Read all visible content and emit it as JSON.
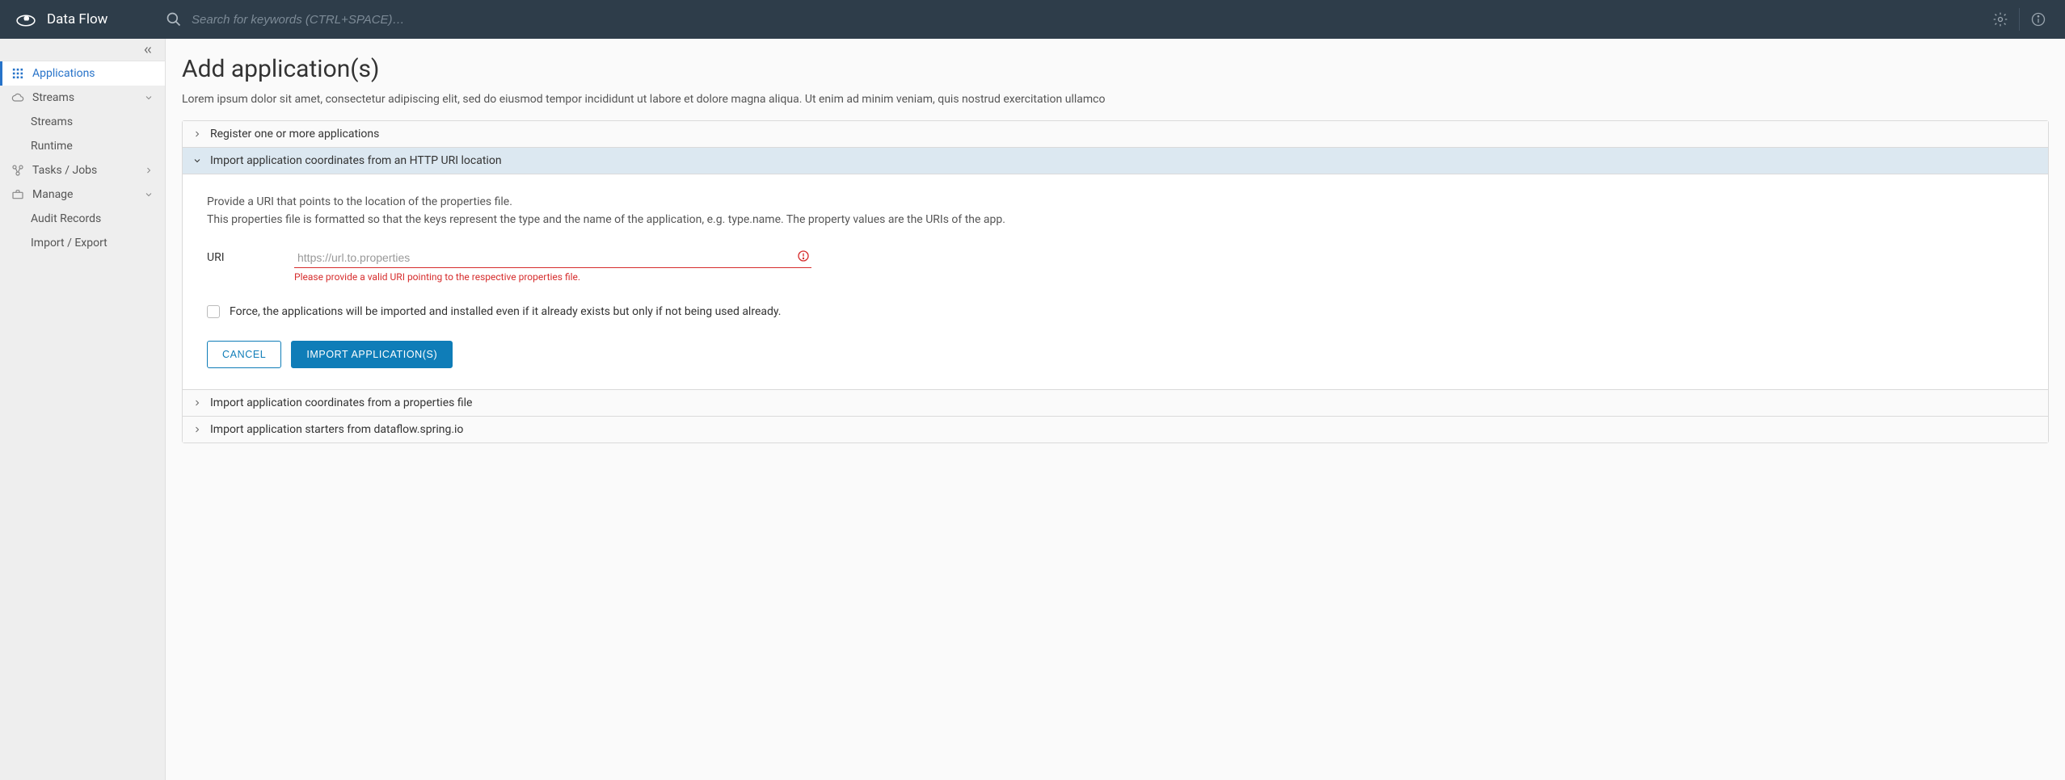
{
  "header": {
    "brand": "Data Flow",
    "search_placeholder": "Search for keywords (CTRL+SPACE)…"
  },
  "sidebar": {
    "items": [
      {
        "label": "Applications"
      },
      {
        "label": "Streams"
      },
      {
        "label": "Streams"
      },
      {
        "label": "Runtime"
      },
      {
        "label": "Tasks / Jobs"
      },
      {
        "label": "Manage"
      },
      {
        "label": "Audit Records"
      },
      {
        "label": "Import / Export"
      }
    ]
  },
  "page": {
    "title": "Add application(s)",
    "description": "Lorem ipsum dolor sit amet, consectetur adipiscing elit, sed do eiusmod tempor incididunt ut labore et dolore magna aliqua. Ut enim ad minim veniam, quis nostrud exercitation ullamco"
  },
  "accordion": {
    "s0": "Register one or more applications",
    "s1": "Import application coordinates from an HTTP URI location",
    "s2": "Import application coordinates from a properties file",
    "s3": "Import application starters from dataflow.spring.io"
  },
  "form": {
    "hint_l1": "Provide a URI that points to the location of the properties file.",
    "hint_l2": "This properties file is formatted so that the keys represent the type and the name of the application, e.g. type.name. The property values are the URIs of the app.",
    "uri_label": "URI",
    "uri_placeholder": "https://url.to.properties",
    "uri_value": "",
    "uri_error": "Please provide a valid URI pointing to the respective properties file.",
    "force_label": "Force, the applications will be imported and installed even if it already exists but only if not being used already.",
    "cancel": "Cancel",
    "submit": "Import Application(s)"
  }
}
